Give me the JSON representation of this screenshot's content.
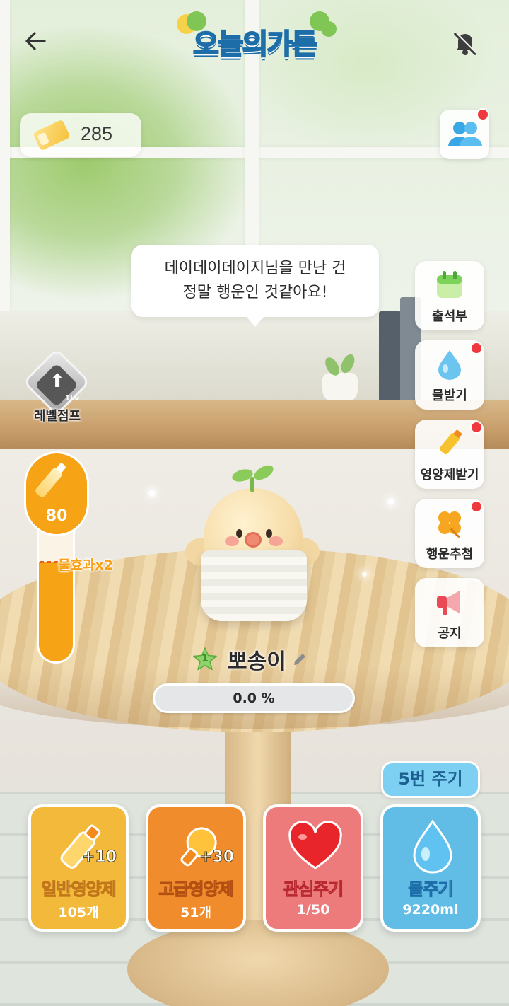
{
  "app": {
    "title": "오늘의가든",
    "back_icon": "back-arrow-icon",
    "bell_icon": "bell-off-icon"
  },
  "currency": {
    "icon": "clover-ticket-icon",
    "value": "285"
  },
  "friends": {
    "icon": "friends-icon",
    "has_notification": true
  },
  "speech": {
    "line1": "데이데이데이지님을 만난 건",
    "line2": "정말 행운인 것같아요!"
  },
  "level_jump": {
    "label": "레벨점프",
    "badge": "1Lv"
  },
  "water_gauge": {
    "value": "80",
    "marker_label": "물효과x2",
    "fill_fraction": 0.52,
    "marker_fraction": 0.56
  },
  "menu": [
    {
      "label": "출석부",
      "icon": "calendar-icon",
      "notify": false
    },
    {
      "label": "물받기",
      "icon": "water-drop-icon",
      "notify": true
    },
    {
      "label": "영양제받기",
      "icon": "nutrient-bottle-icon",
      "notify": true
    },
    {
      "label": "행운추첨",
      "icon": "clover-icon",
      "notify": true
    },
    {
      "label": "공지",
      "icon": "megaphone-icon",
      "notify": false
    }
  ],
  "character": {
    "level": "1",
    "name": "뽀송이",
    "progress_text": "0.0 %",
    "progress_fraction": 0.0
  },
  "actions": {
    "multi_tag": "5번 주기",
    "items": [
      {
        "title": "일반영양제",
        "sub": "105개",
        "plus": "+10",
        "icon": "nutrient-bottle-icon",
        "color": "#f2b93b"
      },
      {
        "title": "고급영양제",
        "sub": "51개",
        "plus": "+30",
        "icon": "premium-nutrient-icon",
        "color": "#f08c2b"
      },
      {
        "title": "관심주기",
        "sub": "1/50",
        "plus": "",
        "icon": "heart-icon",
        "color": "#ee7b7b"
      },
      {
        "title": "물주기",
        "sub": "9220ml",
        "plus": "",
        "icon": "water-drop-icon",
        "color": "#62bde6"
      }
    ]
  },
  "colors": {
    "gauge": "#f7a316",
    "accent_blue": "#4fb6e9",
    "notify_red": "#f0393c"
  }
}
